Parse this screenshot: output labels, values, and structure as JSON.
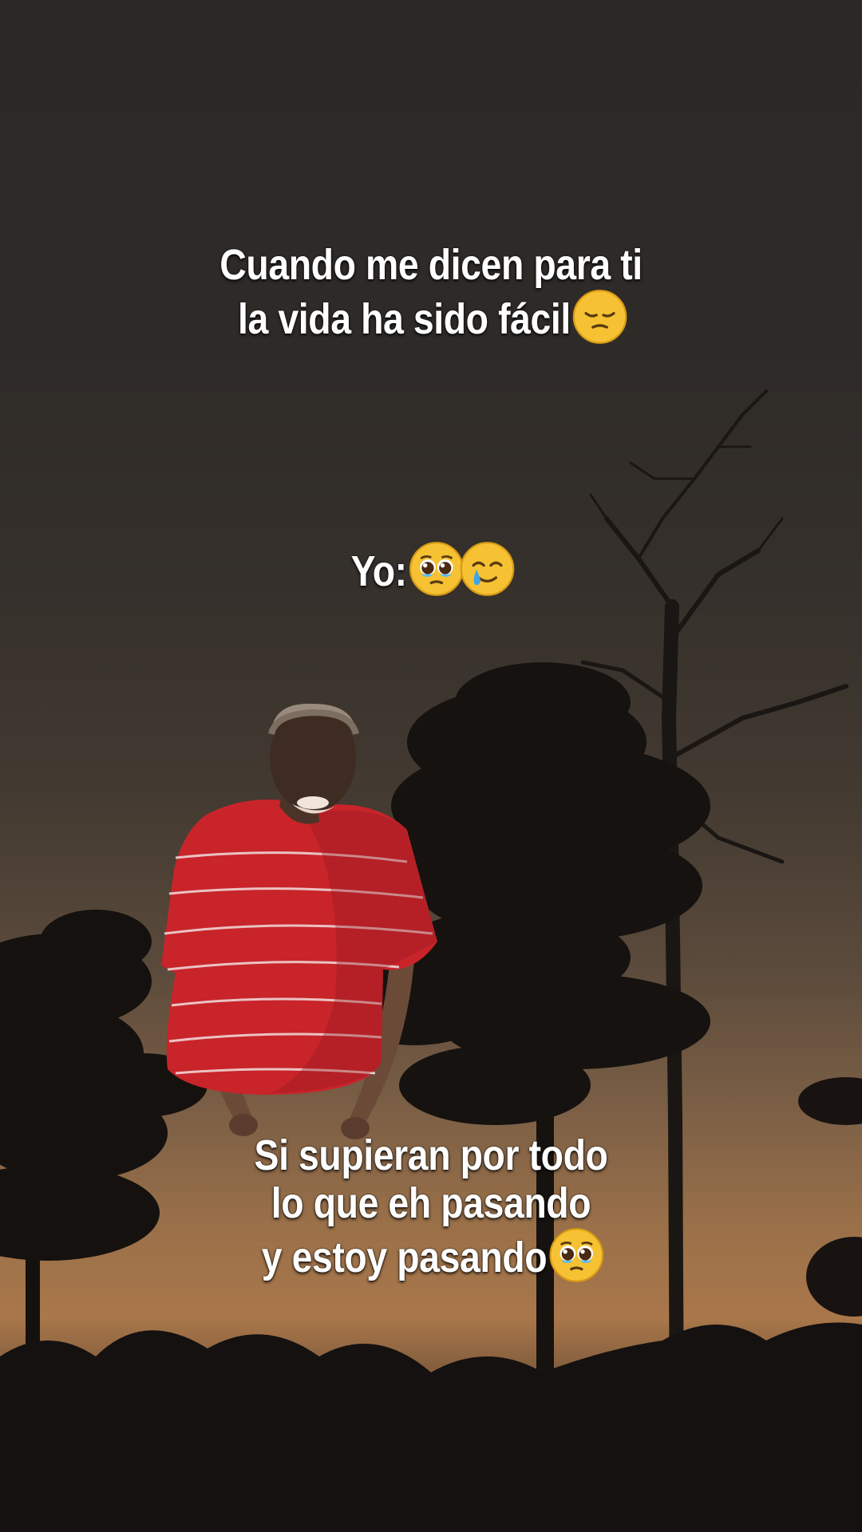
{
  "captions": {
    "top": {
      "line1": "Cuando me dicen para ti",
      "line2": "la vida ha sido fácil",
      "emoji": "pensive-face-icon"
    },
    "middle": {
      "text": "Yo:",
      "emojis": [
        "pleading-face-icon",
        "smiling-face-with-tear-icon"
      ]
    },
    "bottom": {
      "line1": "Si supieran por todo",
      "line2": "lo que eh pasando",
      "line3": "y estoy pasando",
      "emoji": "pleading-face-icon"
    }
  },
  "colors": {
    "text": "#ffffff",
    "sky_dark": "#2b2826",
    "sky_glow": "#a9774a",
    "shirt": "#c8242a",
    "silhouette": "#14110f"
  }
}
